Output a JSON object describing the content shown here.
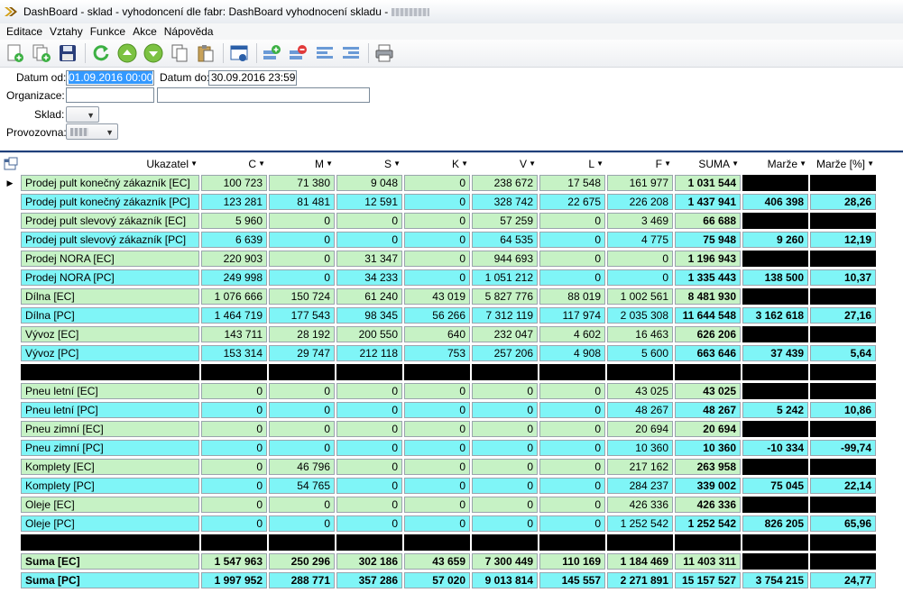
{
  "window": {
    "title": "DashBoard - sklad - vyhodoncení dle fabr: DashBoard vyhodnocení skladu -"
  },
  "menu": [
    "Editace",
    "Vztahy",
    "Funkce",
    "Akce",
    "Nápověda"
  ],
  "toolbar_icons": [
    "new-doc-icon",
    "copy-doc-icon",
    "save-icon",
    "refresh-icon",
    "arrow-up-icon",
    "arrow-down-icon",
    "copy-icon",
    "paste-icon",
    "window-view-icon",
    "add-row-icon",
    "remove-row-icon",
    "align-left-icon",
    "align-right-icon",
    "print-icon"
  ],
  "filters": {
    "datum_od_label": "Datum od:",
    "datum_od_value": "01.09.2016 00:00",
    "datum_do_label": "Datum do:",
    "datum_do_value": "30.09.2016 23:59",
    "organizace_label": "Organizace:",
    "sklad_label": "Sklad:",
    "provozovna_label": "Provozovna:"
  },
  "grid": {
    "columns": [
      "Ukazatel",
      "C",
      "M",
      "S",
      "K",
      "V",
      "L",
      "F",
      "SUMA",
      "Marže",
      "Marže [%]"
    ],
    "rows": [
      {
        "kind": "ec",
        "cells": [
          "Prodej pult konečný zákazník [EC]",
          "100 723",
          "71 380",
          "9 048",
          "0",
          "238 672",
          "17 548",
          "161 977",
          "1 031 544",
          "",
          ""
        ]
      },
      {
        "kind": "pc",
        "cells": [
          "Prodej pult konečný zákazník [PC]",
          "123 281",
          "81 481",
          "12 591",
          "0",
          "328 742",
          "22 675",
          "226 208",
          "1 437 941",
          "406 398",
          "28,26"
        ]
      },
      {
        "kind": "ec",
        "cells": [
          "Prodej pult slevový zákazník [EC]",
          "5 960",
          "0",
          "0",
          "0",
          "57 259",
          "0",
          "3 469",
          "66 688",
          "",
          ""
        ]
      },
      {
        "kind": "pc",
        "cells": [
          "Prodej pult slevový zákazník [PC]",
          "6 639",
          "0",
          "0",
          "0",
          "64 535",
          "0",
          "4 775",
          "75 948",
          "9 260",
          "12,19"
        ]
      },
      {
        "kind": "ec",
        "cells": [
          "Prodej NORA [EC]",
          "220 903",
          "0",
          "31 347",
          "0",
          "944 693",
          "0",
          "0",
          "1 196 943",
          "",
          ""
        ]
      },
      {
        "kind": "pc",
        "cells": [
          "Prodej NORA [PC]",
          "249 998",
          "0",
          "34 233",
          "0",
          "1 051 212",
          "0",
          "0",
          "1 335 443",
          "138 500",
          "10,37"
        ]
      },
      {
        "kind": "ec",
        "cells": [
          "Dílna [EC]",
          "1 076 666",
          "150 724",
          "61 240",
          "43 019",
          "5 827 776",
          "88 019",
          "1 002 561",
          "8 481 930",
          "",
          ""
        ]
      },
      {
        "kind": "pc",
        "cells": [
          "Dílna [PC]",
          "1 464 719",
          "177 543",
          "98 345",
          "56 266",
          "7 312 119",
          "117 974",
          "2 035 308",
          "11 644 548",
          "3 162 618",
          "27,16"
        ]
      },
      {
        "kind": "ec",
        "cells": [
          "Vývoz [EC]",
          "143 711",
          "28 192",
          "200 550",
          "640",
          "232 047",
          "4 602",
          "16 463",
          "626 206",
          "",
          ""
        ]
      },
      {
        "kind": "pc",
        "cells": [
          "Vývoz [PC]",
          "153 314",
          "29 747",
          "212 118",
          "753",
          "257 206",
          "4 908",
          "5 600",
          "663 646",
          "37 439",
          "5,64"
        ]
      },
      {
        "kind": "black",
        "cells": [
          "",
          "",
          "",
          "",
          "",
          "",
          "",
          "",
          "",
          "",
          ""
        ]
      },
      {
        "kind": "ec",
        "cells": [
          "Pneu letní [EC]",
          "0",
          "0",
          "0",
          "0",
          "0",
          "0",
          "43 025",
          "43 025",
          "",
          ""
        ]
      },
      {
        "kind": "pc",
        "cells": [
          "Pneu letní [PC]",
          "0",
          "0",
          "0",
          "0",
          "0",
          "0",
          "48 267",
          "48 267",
          "5 242",
          "10,86"
        ]
      },
      {
        "kind": "ec",
        "cells": [
          "Pneu zimní [EC]",
          "0",
          "0",
          "0",
          "0",
          "0",
          "0",
          "20 694",
          "20 694",
          "",
          ""
        ]
      },
      {
        "kind": "pc",
        "cells": [
          "Pneu zimní [PC]",
          "0",
          "0",
          "0",
          "0",
          "0",
          "0",
          "10 360",
          "10 360",
          "-10 334",
          "-99,74"
        ]
      },
      {
        "kind": "ec",
        "cells": [
          "Komplety [EC]",
          "0",
          "46 796",
          "0",
          "0",
          "0",
          "0",
          "217 162",
          "263 958",
          "",
          ""
        ]
      },
      {
        "kind": "pc",
        "cells": [
          "Komplety [PC]",
          "0",
          "54 765",
          "0",
          "0",
          "0",
          "0",
          "284 237",
          "339 002",
          "75 045",
          "22,14"
        ]
      },
      {
        "kind": "ec",
        "cells": [
          "Oleje [EC]",
          "0",
          "0",
          "0",
          "0",
          "0",
          "0",
          "426 336",
          "426 336",
          "",
          ""
        ]
      },
      {
        "kind": "pc",
        "cells": [
          "Oleje [PC]",
          "0",
          "0",
          "0",
          "0",
          "0",
          "0",
          "1 252 542",
          "1 252 542",
          "826 205",
          "65,96"
        ]
      },
      {
        "kind": "black",
        "cells": [
          "",
          "",
          "",
          "",
          "",
          "",
          "",
          "",
          "",
          "",
          ""
        ]
      },
      {
        "kind": "sum_ec",
        "cells": [
          "Suma [EC]",
          "1 547 963",
          "250 296",
          "302 186",
          "43 659",
          "7 300 449",
          "110 169",
          "1 184 469",
          "11 403 311",
          "",
          ""
        ]
      },
      {
        "kind": "sum_pc",
        "cells": [
          "Suma [PC]",
          "1 997 952",
          "288 771",
          "357 286",
          "57 020",
          "9 013 814",
          "145 557",
          "2 271 891",
          "15 157 527",
          "3 754 215",
          "24,77"
        ]
      }
    ]
  },
  "colors": {
    "ec_row": "#c6f2c5",
    "pc_row": "#7ff5f7",
    "masked": "#000000"
  }
}
